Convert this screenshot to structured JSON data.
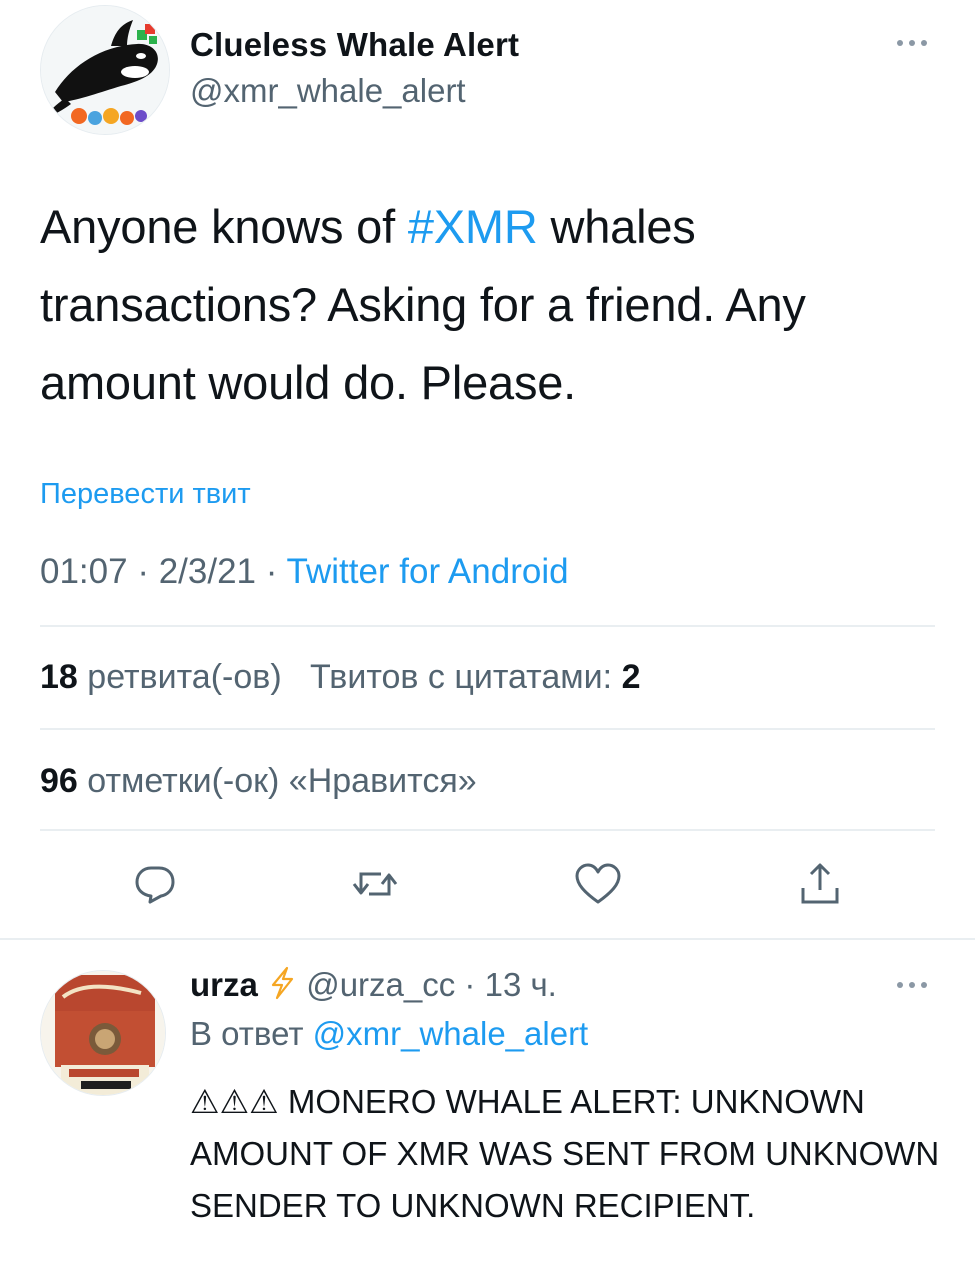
{
  "tweet": {
    "author_name": "Clueless Whale Alert",
    "author_handle": "@xmr_whale_alert",
    "text_part1": "Anyone knows of ",
    "hashtag": "#XMR",
    "text_part2": " whales transactions? Asking for a friend. Any amount would do. Please.",
    "translate_label": "Перевести твит",
    "time": "01:07",
    "date": "2/3/21",
    "separator": " · ",
    "source": "Twitter for Android"
  },
  "stats": {
    "retweets_count": "18",
    "retweets_label": "ретвита(-ов)",
    "quotes_label": "Твитов с цитатами:",
    "quotes_count": "2",
    "likes_count": "96",
    "likes_label": "отметки(-ок) «Нравится»"
  },
  "actions": {
    "reply_icon": "reply-bubble-icon",
    "retweet_icon": "retweet-icon",
    "like_icon": "heart-icon",
    "share_icon": "share-icon"
  },
  "reply": {
    "author_name": "urza",
    "badge_icon": "lightning-bolt-icon",
    "author_handle": "@urza_cc",
    "time_sep": " · ",
    "time": "13 ч.",
    "reply_prefix": "В ответ ",
    "reply_to": "@xmr_whale_alert",
    "text": "⚠⚠⚠ MONERO WHALE ALERT: UNKNOWN AMOUNT OF XMR WAS SENT FROM UNKNOWN SENDER TO UNKNOWN RECIPIENT."
  },
  "colors": {
    "accent": "#1d9bf0",
    "text": "#0f1419",
    "muted": "#536471",
    "divider": "#e9eef1",
    "bolt": "#f5a623"
  }
}
